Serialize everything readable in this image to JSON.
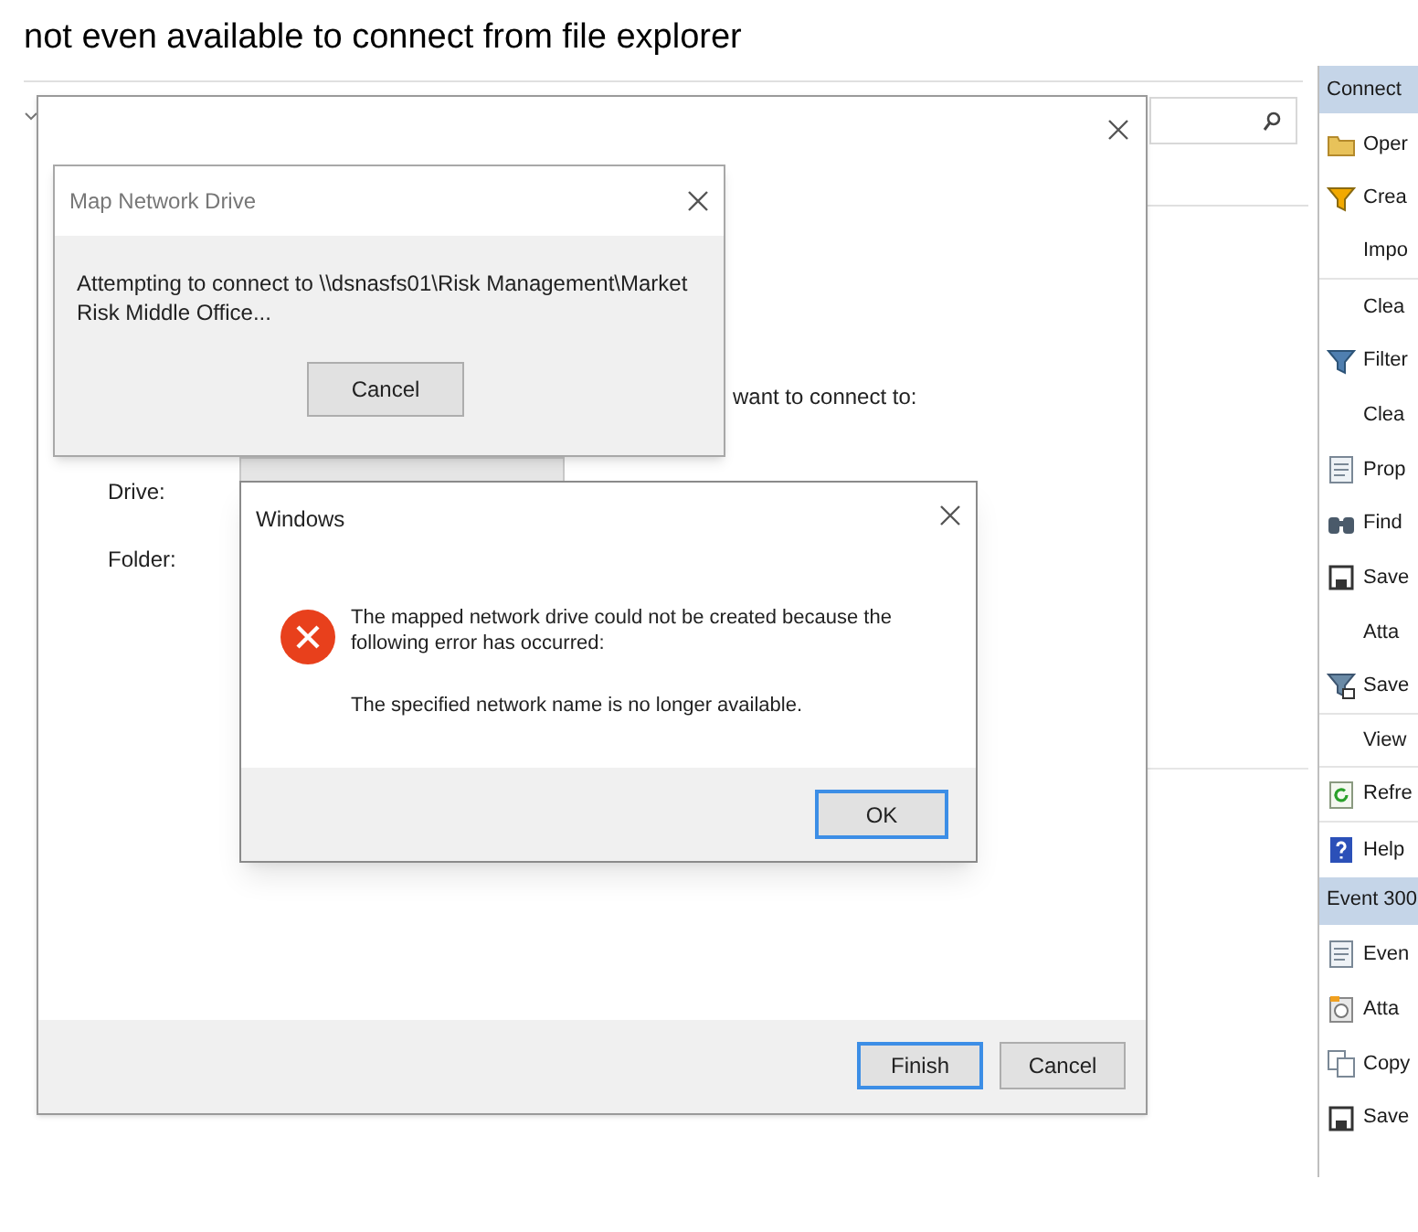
{
  "caption": "not even available to connect from file explorer",
  "wizard": {
    "prompt_fragment": "want to connect to:",
    "fields": [
      {
        "label": "Drive:"
      },
      {
        "label": "Folder:"
      }
    ],
    "buttons": [
      {
        "label": "Finish",
        "default": true
      },
      {
        "label": "Cancel",
        "default": false
      }
    ]
  },
  "progress_dialog": {
    "title": "Map Network Drive",
    "message": "Attempting to connect to \\\\dsnasfs01\\Risk Management\\Market Risk  Middle Office...",
    "button": "Cancel"
  },
  "error_dialog": {
    "title": "Windows",
    "message": "The mapped network drive could not be created because the following error has occurred:",
    "detail": "The specified network name is no longer available.",
    "button": {
      "label": "OK",
      "default": true
    }
  },
  "actions_panel": {
    "sections": [
      {
        "title": "Connect",
        "items": [
          "Oper",
          "Crea",
          "Impo",
          "Clea",
          "Filter",
          "Clea",
          "Prop",
          "Find",
          "Save",
          "Atta",
          "Save",
          "View",
          "Refre",
          "Help"
        ]
      },
      {
        "title": "Event 300",
        "items": [
          "Even",
          "Atta",
          "Copy",
          "Save"
        ]
      }
    ]
  }
}
